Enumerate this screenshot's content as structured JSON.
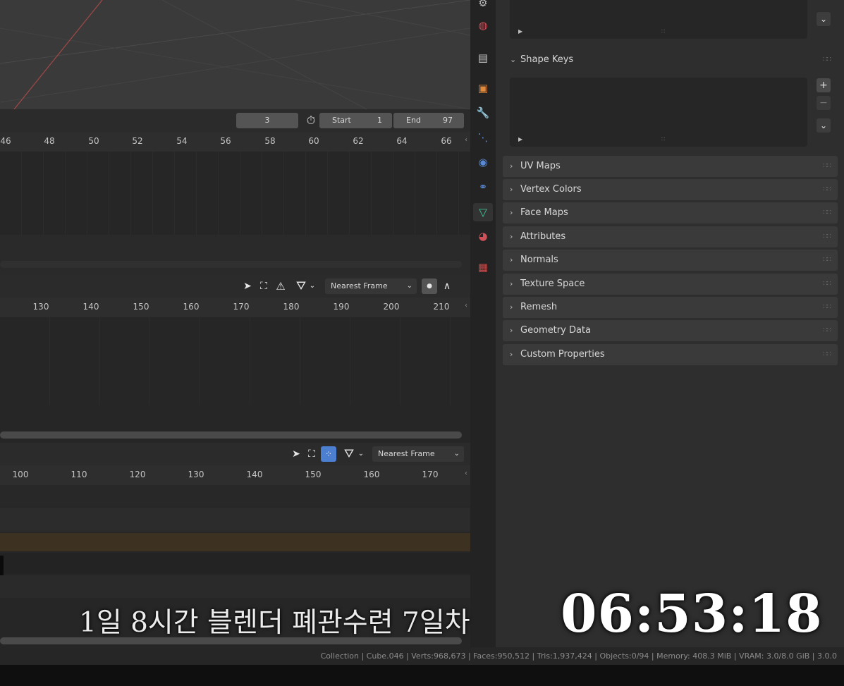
{
  "timeline": {
    "current_frame": "3",
    "start_label": "Start",
    "start_value": "1",
    "end_label": "End",
    "end_value": "97",
    "ruler_ticks": [
      "46",
      "48",
      "50",
      "52",
      "54",
      "56",
      "58",
      "60",
      "62",
      "64",
      "66"
    ]
  },
  "dopesheet": {
    "snap_mode": "Nearest Frame",
    "ruler_ticks": [
      "130",
      "140",
      "150",
      "160",
      "170",
      "180",
      "190",
      "200",
      "210"
    ]
  },
  "nla": {
    "snap_mode": "Nearest Frame",
    "ruler_ticks": [
      "100",
      "110",
      "120",
      "130",
      "140",
      "150",
      "160",
      "170"
    ]
  },
  "properties": {
    "shape_keys_label": "Shape Keys",
    "panels": [
      "UV Maps",
      "Vertex Colors",
      "Face Maps",
      "Attributes",
      "Normals",
      "Texture Space",
      "Remesh",
      "Geometry Data",
      "Custom Properties"
    ]
  },
  "tabs": [
    "world-icon",
    "scene-icon",
    "object-icon",
    "modifier-icon",
    "particles-icon",
    "physics-icon",
    "constraints-icon",
    "data-icon",
    "material-icon",
    "texture-icon"
  ],
  "statusbar": {
    "text": "Collection | Cube.046 | Verts:968,673 | Faces:950,512 | Tris:1,937,424 | Objects:0/94 | Memory: 408.3 MiB | VRAM: 3.0/8.0 GiB | 3.0.0"
  },
  "overlay": {
    "title": "1일 8시간 블렌더 폐관수련 7일차",
    "time": "06:53:18"
  },
  "colors": {
    "accent": "#4d7fd1",
    "data_tab": "#3ccf9a",
    "orange_track": "#3d3222"
  }
}
